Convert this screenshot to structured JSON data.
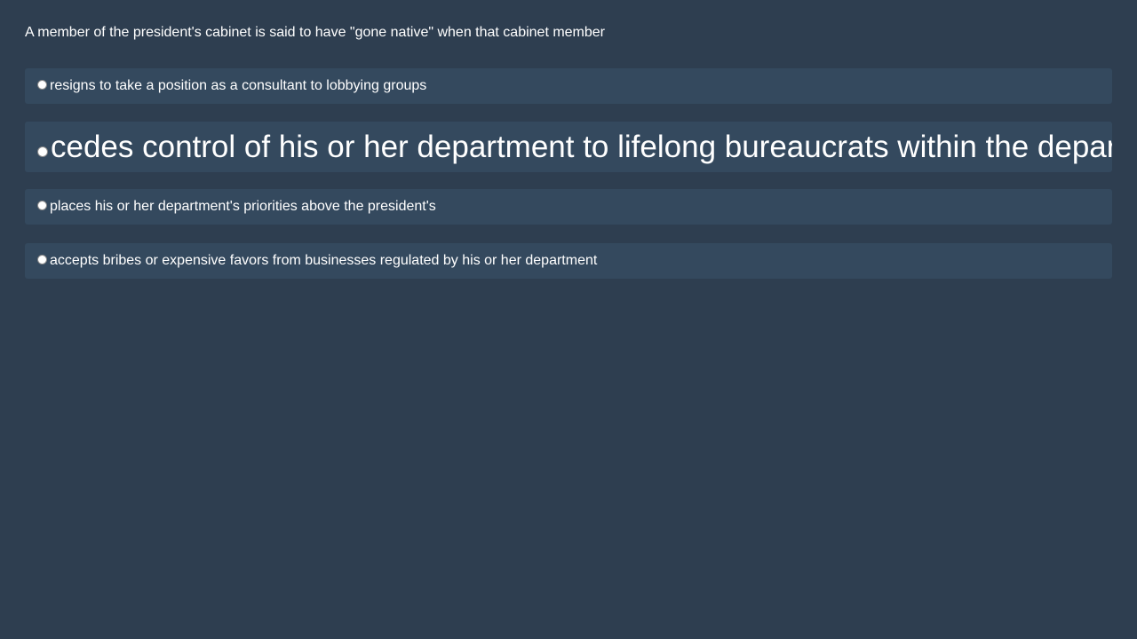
{
  "question": {
    "text": "A member of the president's cabinet is said to have \"gone native\" when that cabinet member"
  },
  "options": [
    {
      "label": "resigns to take a position as a consultant to lobbying groups",
      "selected": false
    },
    {
      "label": "cedes control of his or her department to lifelong bureaucrats within the department",
      "selected": false
    },
    {
      "label": "places his or her department's priorities above the president's",
      "selected": false
    },
    {
      "label": "accepts bribes or expensive favors from businesses regulated by his or her department",
      "selected": false
    }
  ],
  "colors": {
    "background": "#2e3e50",
    "option_background": "#34495e",
    "text": "#ffffff"
  }
}
